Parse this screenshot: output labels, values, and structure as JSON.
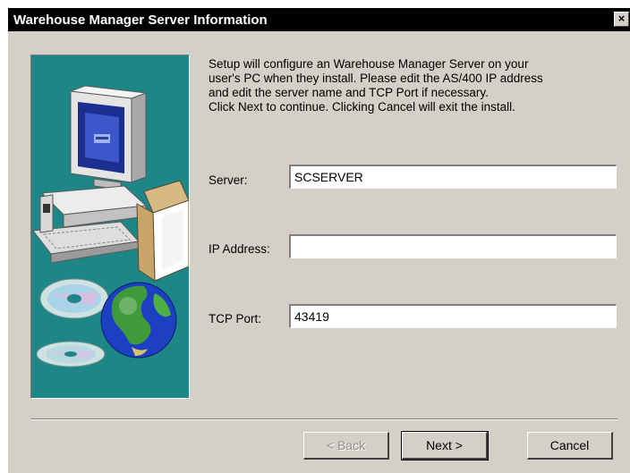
{
  "window": {
    "title": "Warehouse Manager Server Information",
    "close_label": "×"
  },
  "intro_text": "Setup will configure an Warehouse Manager Server on your\nuser's PC when they install. Please edit the AS/400 IP address\nand edit the server name and TCP Port if necessary.\nClick Next to continue. Clicking Cancel will exit the install.",
  "fields": {
    "server": {
      "label": "Server:",
      "value": "SCSERVER"
    },
    "ip_address": {
      "label": "IP Address:",
      "value": ""
    },
    "tcp_port": {
      "label": "TCP Port:",
      "value": "43419"
    }
  },
  "buttons": {
    "back": {
      "label": "< Back",
      "enabled": false
    },
    "next": {
      "label": "Next >",
      "enabled": true,
      "default": true
    },
    "cancel": {
      "label": "Cancel",
      "enabled": true
    }
  },
  "colors": {
    "titlebar": "#000000",
    "dialog_face": "#d4d0c8",
    "art_background": "#1d8787"
  },
  "art": {
    "items": [
      "computer-monitor-icon",
      "keyboard-icon",
      "software-box-icon",
      "cd-disc-icon",
      "globe-icon"
    ]
  }
}
